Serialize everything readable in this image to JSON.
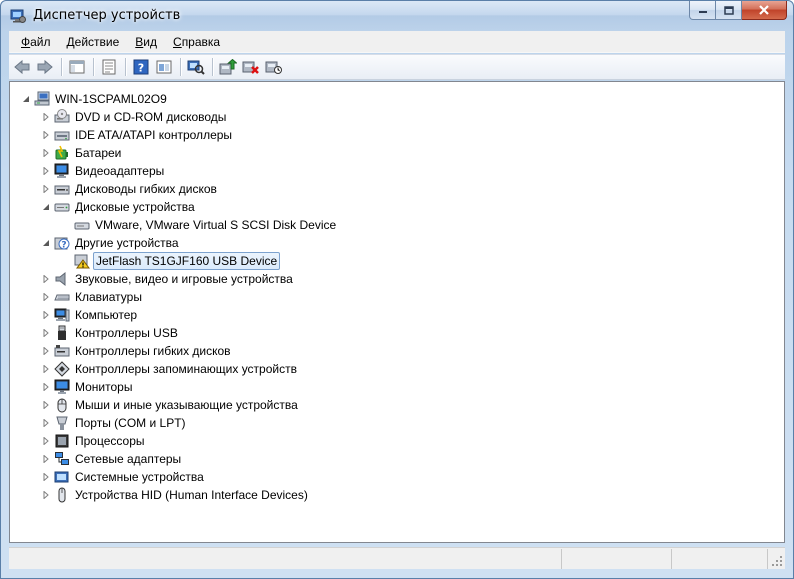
{
  "window": {
    "title": "Диспетчер устройств"
  },
  "menu": {
    "items": [
      {
        "accel": "Ф",
        "rest": "айл"
      },
      {
        "accel": "Д",
        "rest": "ействие"
      },
      {
        "accel": "В",
        "rest": "ид"
      },
      {
        "accel": "С",
        "rest": "правка"
      }
    ]
  },
  "toolbar": {
    "icons": [
      "back-icon",
      "forward-icon",
      "up-view-icon",
      "properties-icon",
      "help-icon",
      "view-icon",
      "scan-hardware-icon",
      "update-driver-icon",
      "uninstall-icon",
      "disable-icon"
    ]
  },
  "tree": {
    "root": "WIN-1SCPAML02O9",
    "items": [
      {
        "label": "DVD и CD-ROM дисководы",
        "icon": "dvd-drive-icon",
        "state": "collapsed"
      },
      {
        "label": "IDE ATA/ATAPI контроллеры",
        "icon": "ide-controller-icon",
        "state": "collapsed"
      },
      {
        "label": "Батареи",
        "icon": "battery-icon",
        "state": "collapsed"
      },
      {
        "label": "Видеоадаптеры",
        "icon": "display-adapter-icon",
        "state": "collapsed"
      },
      {
        "label": "Дисководы гибких дисков",
        "icon": "floppy-drive-icon",
        "state": "collapsed"
      },
      {
        "label": "Дисковые устройства",
        "icon": "disk-drive-icon",
        "state": "expanded"
      },
      {
        "label": "VMware, VMware Virtual S SCSI Disk Device",
        "icon": "disk-device-icon",
        "state": "child"
      },
      {
        "label": "Другие устройства",
        "icon": "unknown-device-icon",
        "state": "expanded"
      },
      {
        "label": "JetFlash TS1GJF160 USB Device",
        "icon": "warning-device-icon",
        "state": "child-selected"
      },
      {
        "label": "Звуковые, видео и игровые устройства",
        "icon": "speaker-icon",
        "state": "collapsed"
      },
      {
        "label": "Клавиатуры",
        "icon": "keyboard-icon",
        "state": "collapsed"
      },
      {
        "label": "Компьютер",
        "icon": "computer-icon",
        "state": "collapsed"
      },
      {
        "label": "Контроллеры USB",
        "icon": "usb-icon",
        "state": "collapsed"
      },
      {
        "label": "Контроллеры гибких дисков",
        "icon": "floppy-controller-icon",
        "state": "collapsed"
      },
      {
        "label": "Контроллеры запоминающих устройств",
        "icon": "storage-controller-icon",
        "state": "collapsed"
      },
      {
        "label": "Мониторы",
        "icon": "monitor-icon",
        "state": "collapsed"
      },
      {
        "label": "Мыши и иные указывающие устройства",
        "icon": "mouse-icon",
        "state": "collapsed"
      },
      {
        "label": "Порты (COM и LPT)",
        "icon": "port-icon",
        "state": "collapsed"
      },
      {
        "label": "Процессоры",
        "icon": "processor-icon",
        "state": "collapsed"
      },
      {
        "label": "Сетевые адаптеры",
        "icon": "network-adapter-icon",
        "state": "collapsed"
      },
      {
        "label": "Системные устройства",
        "icon": "system-device-icon",
        "state": "collapsed"
      },
      {
        "label": "Устройства HID (Human Interface Devices)",
        "icon": "hid-icon",
        "state": "collapsed"
      }
    ]
  },
  "colors": {
    "selection_border": "#7da2ce",
    "selection_fill": "#dcebfc",
    "close_button": "#c0432a"
  }
}
